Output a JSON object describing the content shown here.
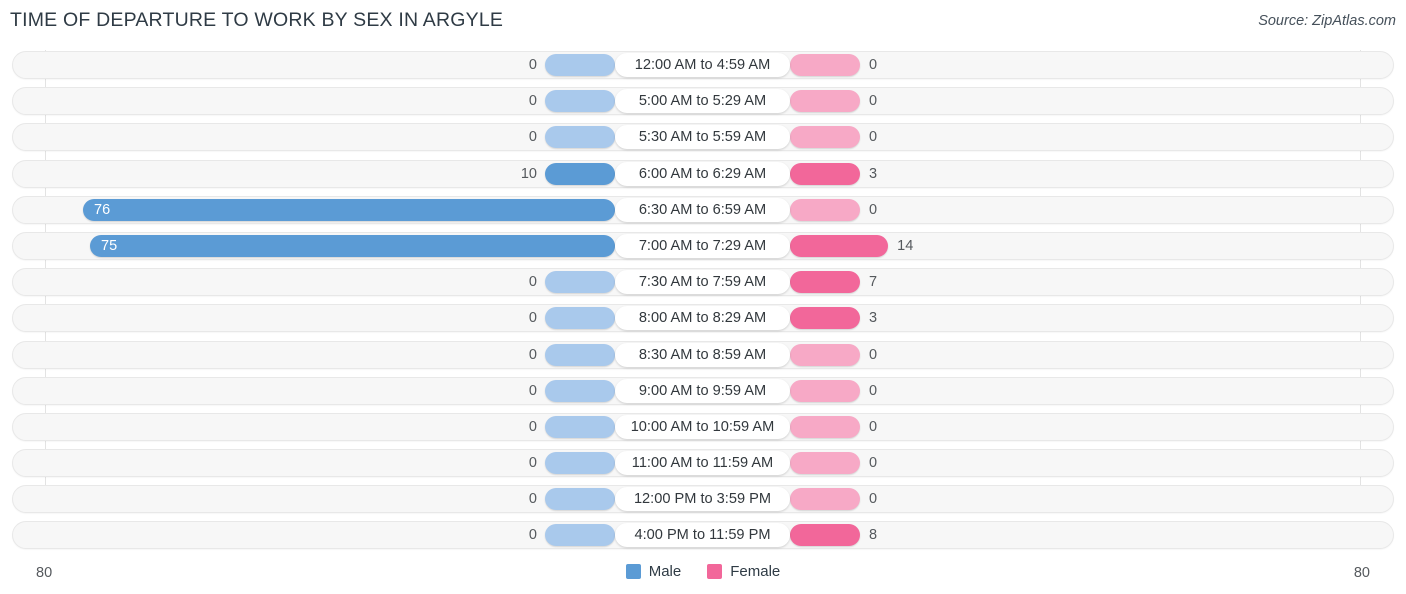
{
  "header": {
    "title": "TIME OF DEPARTURE TO WORK BY SEX IN ARGYLE",
    "source": "Source: ZipAtlas.com"
  },
  "footer": {
    "axis_left": "80",
    "axis_right": "80",
    "legend": [
      {
        "label": "Male",
        "color": "#5b9bd5"
      },
      {
        "label": "Female",
        "color": "#f2679a"
      }
    ]
  },
  "colors": {
    "male_strong": "#5b9bd5",
    "male_faint": "#a9c9ec",
    "female_strong": "#f2679a",
    "female_faint": "#f7a9c6",
    "track": "#f7f7f7",
    "title": "#2f3b45"
  },
  "chart_data": {
    "type": "bar",
    "subtype": "diverging-bidirectional-bar",
    "title": "TIME OF DEPARTURE TO WORK BY SEX IN ARGYLE",
    "source": "Source: ZipAtlas.com",
    "xlabel": "",
    "ylabel": "",
    "axis_max_left": 80,
    "axis_max_right": 80,
    "xlim": [
      80,
      80
    ],
    "grid": true,
    "legend_position": "bottom-center",
    "categories": [
      "12:00 AM to 4:59 AM",
      "5:00 AM to 5:29 AM",
      "5:30 AM to 5:59 AM",
      "6:00 AM to 6:29 AM",
      "6:30 AM to 6:59 AM",
      "7:00 AM to 7:29 AM",
      "7:30 AM to 7:59 AM",
      "8:00 AM to 8:29 AM",
      "8:30 AM to 8:59 AM",
      "9:00 AM to 9:59 AM",
      "10:00 AM to 10:59 AM",
      "11:00 AM to 11:59 AM",
      "12:00 PM to 3:59 PM",
      "4:00 PM to 11:59 PM"
    ],
    "series": [
      {
        "name": "Male",
        "color": "#5b9bd5",
        "direction": "left",
        "values": [
          0,
          0,
          0,
          10,
          76,
          75,
          0,
          0,
          0,
          0,
          0,
          0,
          0,
          0
        ]
      },
      {
        "name": "Female",
        "color": "#f2679a",
        "direction": "right",
        "values": [
          0,
          0,
          0,
          3,
          0,
          14,
          7,
          3,
          0,
          0,
          0,
          0,
          0,
          8
        ]
      }
    ]
  }
}
